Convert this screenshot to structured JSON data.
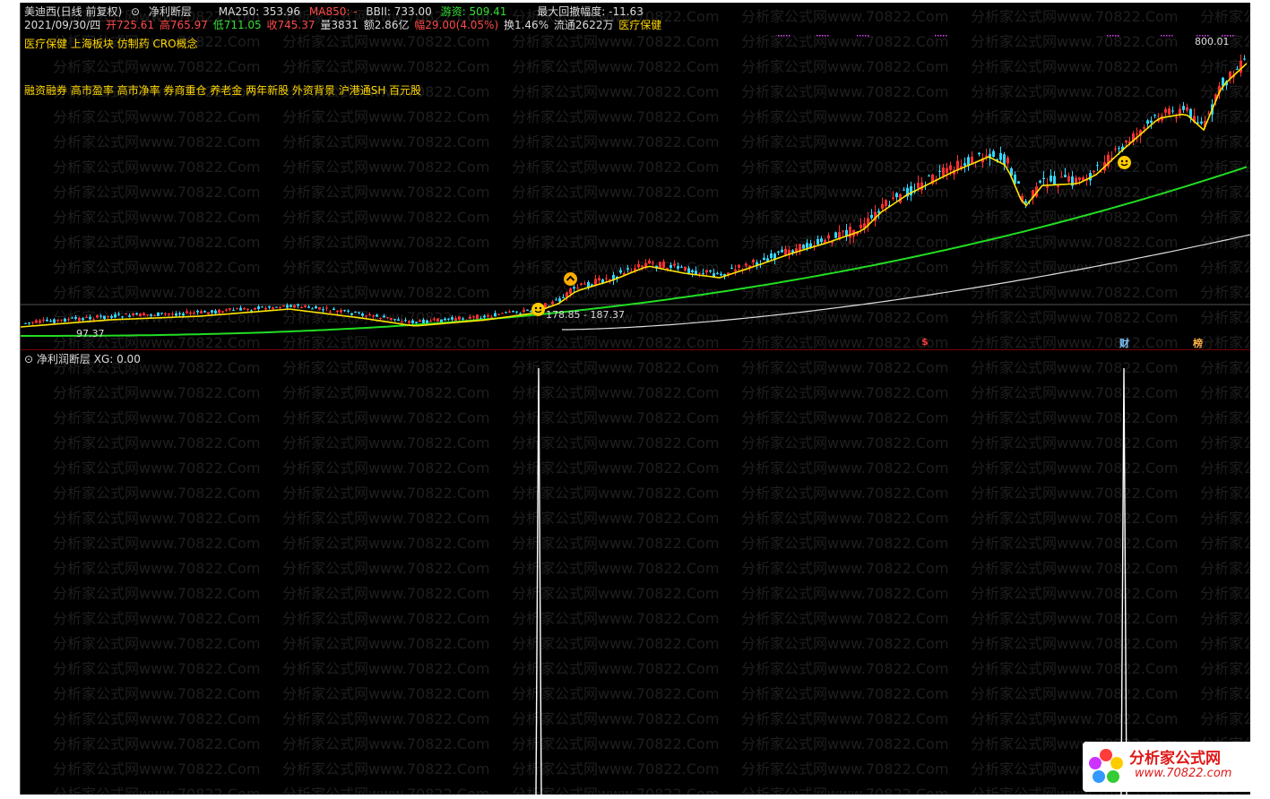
{
  "header": {
    "stock_name": "美迪西(日线 前复权)",
    "indicator_name": "净利断层",
    "ma250": "MA250: 353.96",
    "ma850": "MA850: -",
    "bbii": "BBII: 733.00",
    "youzi": "游资: 509.41",
    "max_drawdown": "最大回撤幅度: -11.63"
  },
  "quote": {
    "date": "2021/09/30/四",
    "open": "开725.61",
    "high": "高765.97",
    "low": "低711.05",
    "close": "收745.37",
    "volume": "量3831",
    "amount": "额2.86亿",
    "change": "幅29.00(4.05%)",
    "turnover": "换1.46%",
    "float": "流通2622万",
    "sector": "医疗保健"
  },
  "concepts_line1": "医疗保健 上海板块 仿制药 CRO概念",
  "concepts_line2": "融资融券 高市盈率 高市净率 券商重仓 养老金 两年新股 外资背景 沪港通SH 百元股",
  "labels": {
    "high_price": "800.01",
    "mid_price": "178.85 - 187.37",
    "low_price": "97.37",
    "event_dollar": "$",
    "event_cai": "财",
    "event_bang": "榜"
  },
  "sub_panel": {
    "title": "净利润断层",
    "xg": "XG: 0.00"
  },
  "watermark": "分析家公式网www.70822.Com",
  "logo": {
    "title": "分析家公式网",
    "url": "www.70822.com"
  },
  "colors": {
    "background": "#000000",
    "up": "#ff3030",
    "down": "#33d6ff",
    "ma_fast": "#ffe400",
    "ma_mid": "#22dd22",
    "ma_slow": "#dddddd",
    "signal_line": "#ffffff"
  }
}
